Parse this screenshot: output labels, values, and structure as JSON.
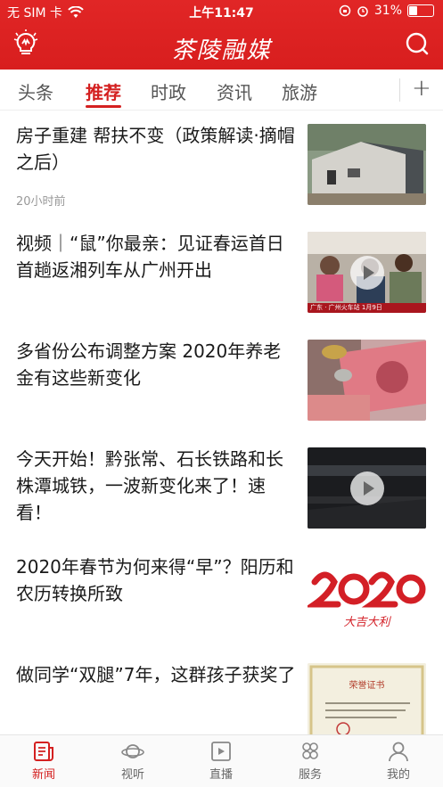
{
  "status": {
    "carrier": "无 SIM 卡",
    "time": "上午11:47",
    "battery": "31%",
    "battery_level": 0.31
  },
  "app": {
    "title": "茶陵融媒",
    "icons": [
      "lightbulb-logo-icon",
      "search-icon"
    ]
  },
  "tabs": [
    {
      "label": "头条"
    },
    {
      "label": "推荐",
      "active": true
    },
    {
      "label": "时政"
    },
    {
      "label": "资讯"
    },
    {
      "label": "旅游"
    }
  ],
  "add_tab_label": "+",
  "news": [
    {
      "title": "房子重建 帮扶不变（政策解读·摘帽之后）",
      "time": "20小时前",
      "thumb": "house-photo"
    },
    {
      "title": "视频｜“鼠”你最亲：见证春运首日首趟返湘列车从广州开出",
      "thumb": "train-passengers-video",
      "overlay": "广东 · 广州火车站  1月9日"
    },
    {
      "title": "多省份公布调整方案 2020年养老金有这些新变化",
      "thumb": "rmb-banknotes-photo"
    },
    {
      "title": "今天开始！黔张常、石长铁路和长株潭城铁，一波新变化来了！速看！",
      "thumb": "railway-station-video"
    },
    {
      "title": "2020年春节为何来得“早”？阳历和农历转换所致",
      "thumb": "2020-new-year-image",
      "thumb_text": "大吉大利"
    },
    {
      "title": "做同学“双腿”7年，这群孩子获奖了",
      "thumb": "certificate-image",
      "thumb_text": "荣誉证书"
    }
  ],
  "bottom_nav": [
    {
      "label": "新闻",
      "icon": "news-icon",
      "active": true
    },
    {
      "label": "视听",
      "icon": "planet-icon"
    },
    {
      "label": "直播",
      "icon": "live-play-icon"
    },
    {
      "label": "服务",
      "icon": "services-grid-icon"
    },
    {
      "label": "我的",
      "icon": "user-icon"
    }
  ],
  "colors": {
    "brand": "#d81e1e",
    "active": "#d42020"
  }
}
